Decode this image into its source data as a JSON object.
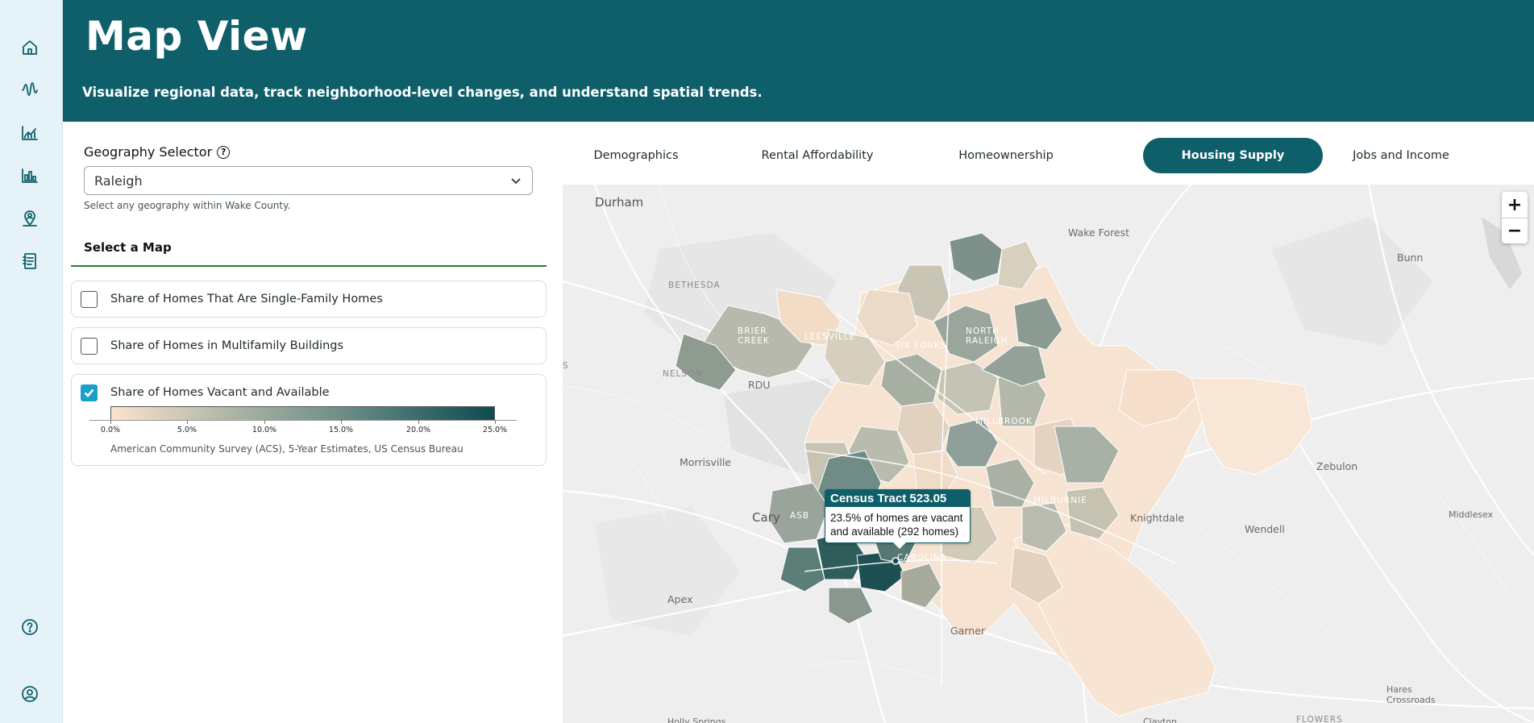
{
  "rail": {
    "icons": [
      "home-icon",
      "pulse-icon",
      "trend-chart-icon",
      "bar-chart-icon",
      "map-pin-person-icon",
      "report-icon",
      "help-icon",
      "account-icon"
    ]
  },
  "header": {
    "title": "Map View",
    "subtitle": "Visualize regional data, track neighborhood-level changes, and understand spatial trends."
  },
  "geography": {
    "label": "Geography Selector",
    "selected": "Raleigh",
    "hint": "Select any geography within Wake County."
  },
  "select_map": {
    "heading": "Select a Map",
    "options": [
      {
        "label": "Share of Homes That Are Single-Family Homes",
        "checked": false
      },
      {
        "label": "Share of Homes in Multifamily Buildings",
        "checked": false
      },
      {
        "label": "Share of Homes Vacant and Available",
        "checked": true
      }
    ],
    "legend": {
      "ticks": [
        "0.0%",
        "5.0%",
        "10.0%",
        "15.0%",
        "20.0%",
        "25.0%"
      ],
      "source": "American Community Survey (ACS), 5-Year Estimates, US Census Bureau",
      "color_low": "#fbe3cd",
      "color_high": "#0e4c52"
    }
  },
  "tabs": {
    "items": [
      "Demographics",
      "Rental Affordability",
      "Homeownership",
      "Housing Supply",
      "Jobs and Income"
    ],
    "active": "Housing Supply"
  },
  "map": {
    "zoom_in": "+",
    "zoom_out": "−",
    "places": {
      "durham": "Durham",
      "wake_forest": "Wake Forest",
      "bunn": "Bunn",
      "bethesda": "BETHESDA",
      "nelson": "NELSON",
      "rdu": "RDU",
      "morrisville": "Morrisville",
      "cary": "Cary",
      "apex": "Apex",
      "garner": "Garner",
      "knightdale": "Knightdale",
      "wendell": "Wendell",
      "zebulon": "Zebulon",
      "middlesex": "Middlesex",
      "hares_crossroads": "Hares\nCrossroads",
      "flowers": "FLOWERS",
      "holly_springs": "Holly Springs",
      "clayton": "Clayton",
      "leesville": "LEESVILLE",
      "six_forks": "SIX FORKS",
      "north_raleigh": "NORTH\nRALEIGH",
      "millbrook": "MILLBROOK",
      "milburnie": "MILBURNIE",
      "carolina": "CAROLINA",
      "asbury": "ASB",
      "brier_creek": "BRIER\nCREEK",
      "s_label": "S"
    },
    "tooltip": {
      "title": "Census Tract 523.05",
      "body": "23.5% of homes are vacant and available (292 homes)",
      "value_percent": 23.5,
      "homes": 292
    }
  }
}
